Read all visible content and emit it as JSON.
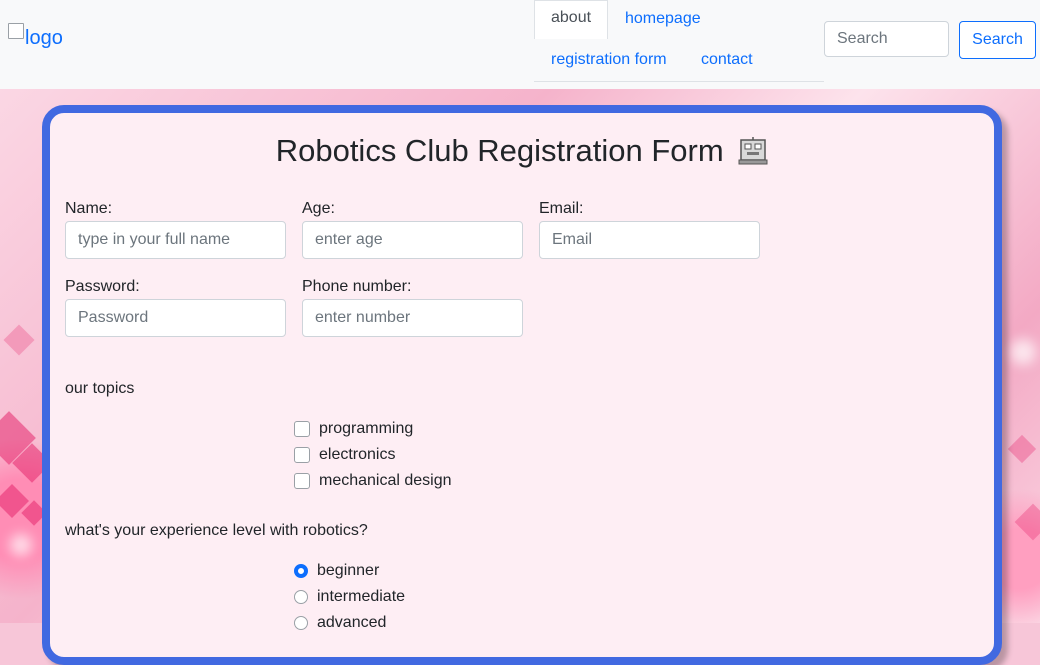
{
  "navbar": {
    "logo_alt": "logo",
    "tabs": [
      {
        "label": "about",
        "active": true
      },
      {
        "label": "homepage"
      },
      {
        "label": "registration form"
      },
      {
        "label": "contact"
      }
    ],
    "search_placeholder": "Search",
    "search_button": "Search"
  },
  "form": {
    "title": "Robotics Club Registration Form",
    "fields": [
      {
        "label": "Name:",
        "placeholder": "type in your full name"
      },
      {
        "label": "Age:",
        "placeholder": "enter age"
      },
      {
        "label": "Email:",
        "placeholder": "Email"
      },
      {
        "label": "Password:",
        "placeholder": "Password"
      },
      {
        "label": "Phone number:",
        "placeholder": "enter number"
      }
    ],
    "topics": {
      "heading": "our topics",
      "options": [
        "programming",
        "electronics",
        "mechanical design"
      ]
    },
    "experience": {
      "heading": "what's your experience level with robotics?",
      "options": [
        "beginner",
        "intermediate",
        "advanced"
      ],
      "selected": "beginner"
    }
  },
  "colors": {
    "accent": "#0d6efd",
    "card_border": "#4169e1",
    "card_bg": "#feeef4"
  }
}
